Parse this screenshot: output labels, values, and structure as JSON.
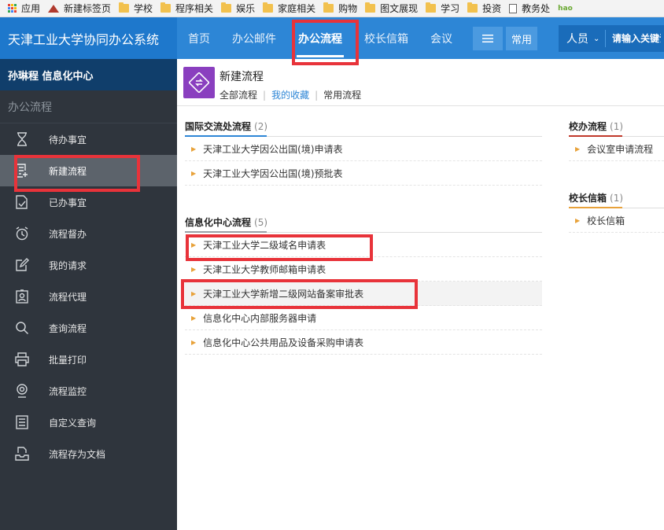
{
  "bookmarks": {
    "items": [
      "应用",
      "新建标签页",
      "学校",
      "程序相关",
      "娱乐",
      "家庭相关",
      "购物",
      "图文展现",
      "学习",
      "投资",
      "教务处"
    ],
    "edge_text": "hao"
  },
  "header": {
    "system_title": "天津工业大学协同办公系统",
    "nav": [
      "首页",
      "办公邮件",
      "办公流程",
      "校长信箱",
      "会议"
    ],
    "active_nav": "办公流程",
    "common_label": "常用",
    "search_scope": "人员",
    "search_placeholder": "请输入关键词"
  },
  "sidebar": {
    "user": "孙琳程  信息化中心",
    "section_title": "办公流程",
    "items": [
      {
        "label": "待办事宜",
        "icon": "hourglass-icon"
      },
      {
        "label": "新建流程",
        "icon": "new-form-icon"
      },
      {
        "label": "已办事宜",
        "icon": "done-doc-icon"
      },
      {
        "label": "流程督办",
        "icon": "alarm-clock-icon"
      },
      {
        "label": "我的请求",
        "icon": "edit-icon"
      },
      {
        "label": "流程代理",
        "icon": "agent-icon"
      },
      {
        "label": "查询流程",
        "icon": "search-icon"
      },
      {
        "label": "批量打印",
        "icon": "printer-icon"
      },
      {
        "label": "流程监控",
        "icon": "monitor-icon"
      },
      {
        "label": "自定义查询",
        "icon": "list-icon"
      },
      {
        "label": "流程存为文档",
        "icon": "save-doc-icon"
      }
    ],
    "active_index": 1
  },
  "main": {
    "title": "新建流程",
    "tabs": [
      "全部流程",
      "我的收藏",
      "常用流程"
    ],
    "active_tab": 1,
    "groups": {
      "intl": {
        "title": "国际交流处流程",
        "count": "(2)",
        "items": [
          "天津工业大学因公出国(境)申请表",
          "天津工业大学因公出国(境)预批表"
        ]
      },
      "info": {
        "title": "信息化中心流程",
        "count": "(5)",
        "items": [
          "天津工业大学二级域名申请表",
          "天津工业大学教师邮箱申请表",
          "天津工业大学新增二级网站备案审批表",
          "信息化中心内部服务器申请",
          "信息化中心公共用品及设备采购申请表"
        ]
      },
      "office": {
        "title": "校办流程",
        "count": "(1)",
        "items": [
          "会议室申请流程"
        ]
      },
      "mailbox": {
        "title": "校长信箱",
        "count": "(1)",
        "items": [
          "校长信箱"
        ]
      }
    }
  },
  "colors": {
    "header_blue": "#2d86d6",
    "brand_blue": "#1e78cc",
    "sidebar_dark": "#2f353d",
    "annotation_red": "#e8333a",
    "app_icon_purple": "#8a3fbf"
  }
}
